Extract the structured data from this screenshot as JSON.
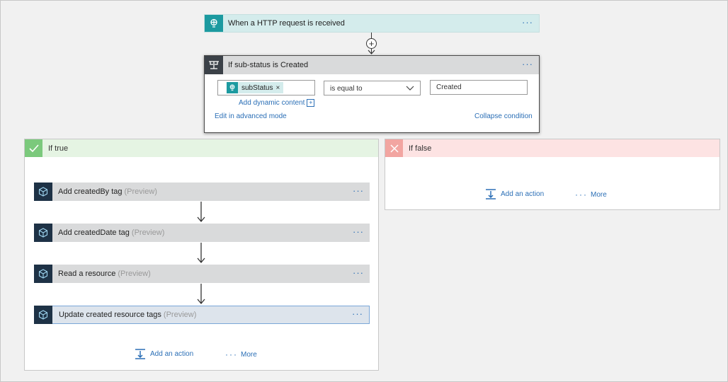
{
  "trigger": {
    "title": "When a HTTP request is received",
    "menu": "···"
  },
  "condition": {
    "title": "If sub-status is Created",
    "menu": "···",
    "token": "subStatus",
    "token_remove": "×",
    "add_dynamic": "Add dynamic content",
    "add_dynamic_icon": "+",
    "operator": "is equal to",
    "value": "Created",
    "edit_advanced": "Edit in advanced mode",
    "collapse": "Collapse condition"
  },
  "branch_true": {
    "label": "If true",
    "actions": [
      {
        "name": "Add createdBy tag",
        "tag": "(Preview)",
        "menu": "···"
      },
      {
        "name": "Add createdDate tag",
        "tag": "(Preview)",
        "menu": "···"
      },
      {
        "name": "Read a resource",
        "tag": "(Preview)",
        "menu": "···"
      },
      {
        "name": "Update created resource tags",
        "tag": "(Preview)",
        "menu": "···"
      }
    ],
    "add_action": "Add an action",
    "more": "More"
  },
  "branch_false": {
    "label": "If false",
    "add_action": "Add an action",
    "more": "More"
  },
  "colors": {
    "teal": "#1c9aa0",
    "link": "#2b6fb6",
    "true_accent": "#7bc97c",
    "false_accent": "#f2a5a1",
    "action_icon": "#1e3246"
  }
}
